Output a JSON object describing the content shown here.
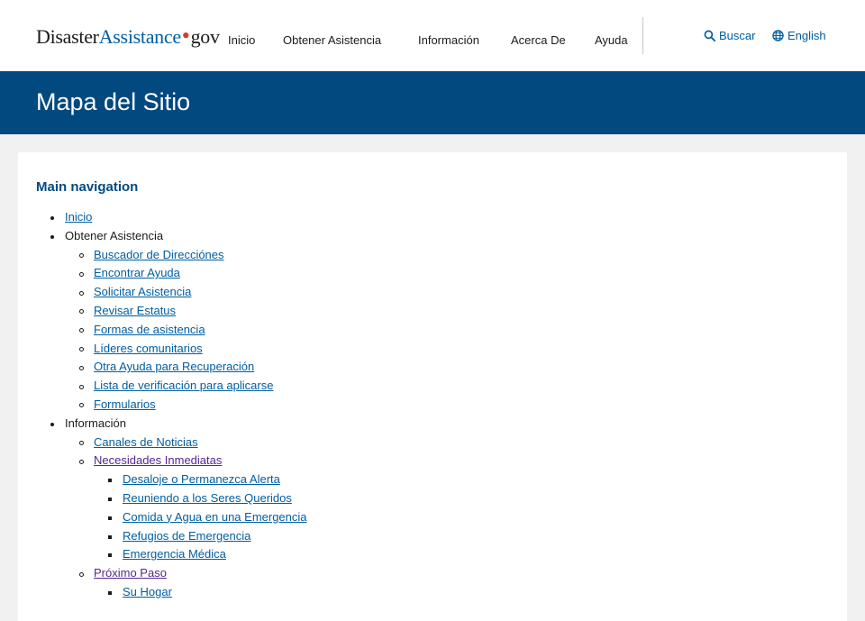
{
  "header": {
    "logo": {
      "part1": "Disaster",
      "part2": "Assistance",
      "dot": "•",
      "part3": "gov"
    },
    "nav": [
      {
        "label": "Inicio"
      },
      {
        "label": "Obtener Asistencia"
      },
      {
        "label": "Información"
      },
      {
        "label": "Acerca De"
      },
      {
        "label": "Ayuda"
      }
    ],
    "search_label": "Buscar",
    "language_label": "English"
  },
  "banner": {
    "title": "Mapa del Sitio"
  },
  "main": {
    "heading": "Main navigation",
    "items": [
      {
        "label": "Inicio",
        "level": 1,
        "link": true,
        "visited": false
      },
      {
        "label": "Obtener Asistencia",
        "level": 1,
        "link": false,
        "visited": false
      },
      {
        "label": "Buscador de Direcciónes",
        "level": 2,
        "link": true,
        "visited": false
      },
      {
        "label": "Encontrar Ayuda",
        "level": 2,
        "link": true,
        "visited": false
      },
      {
        "label": "Solicitar Asistencia",
        "level": 2,
        "link": true,
        "visited": false
      },
      {
        "label": "Revisar Estatus",
        "level": 2,
        "link": true,
        "visited": false
      },
      {
        "label": "Formas de asistencia",
        "level": 2,
        "link": true,
        "visited": false
      },
      {
        "label": "Líderes comunitarios",
        "level": 2,
        "link": true,
        "visited": false
      },
      {
        "label": "Otra Ayuda para Recuperación",
        "level": 2,
        "link": true,
        "visited": false
      },
      {
        "label": "Lista de verificación para aplicarse",
        "level": 2,
        "link": true,
        "visited": false
      },
      {
        "label": "Formularios",
        "level": 2,
        "link": true,
        "visited": false
      },
      {
        "label": "Información",
        "level": 1,
        "link": false,
        "visited": false
      },
      {
        "label": "Canales de Noticias",
        "level": 2,
        "link": true,
        "visited": false
      },
      {
        "label": "Necesidades Inmediatas",
        "level": 2,
        "link": true,
        "visited": true
      },
      {
        "label": "Desaloje o Permanezca Alerta",
        "level": 3,
        "link": true,
        "visited": false
      },
      {
        "label": "Reuniendo a los Seres Queridos",
        "level": 3,
        "link": true,
        "visited": false
      },
      {
        "label": "Comida y Agua en una Emergencia",
        "level": 3,
        "link": true,
        "visited": false
      },
      {
        "label": "Refugios de Emergencia",
        "level": 3,
        "link": true,
        "visited": false
      },
      {
        "label": "Emergencia Médica",
        "level": 3,
        "link": true,
        "visited": false
      },
      {
        "label": "Próximo Paso",
        "level": 2,
        "link": true,
        "visited": true
      },
      {
        "label": "Su Hogar",
        "level": 3,
        "link": true,
        "visited": false
      }
    ]
  },
  "colors": {
    "brand_blue": "#005ea2",
    "banner_blue": "#01497e",
    "heading_blue": "#004b80",
    "visited_purple": "#54278f",
    "logo_dot_red": "#d83933"
  }
}
